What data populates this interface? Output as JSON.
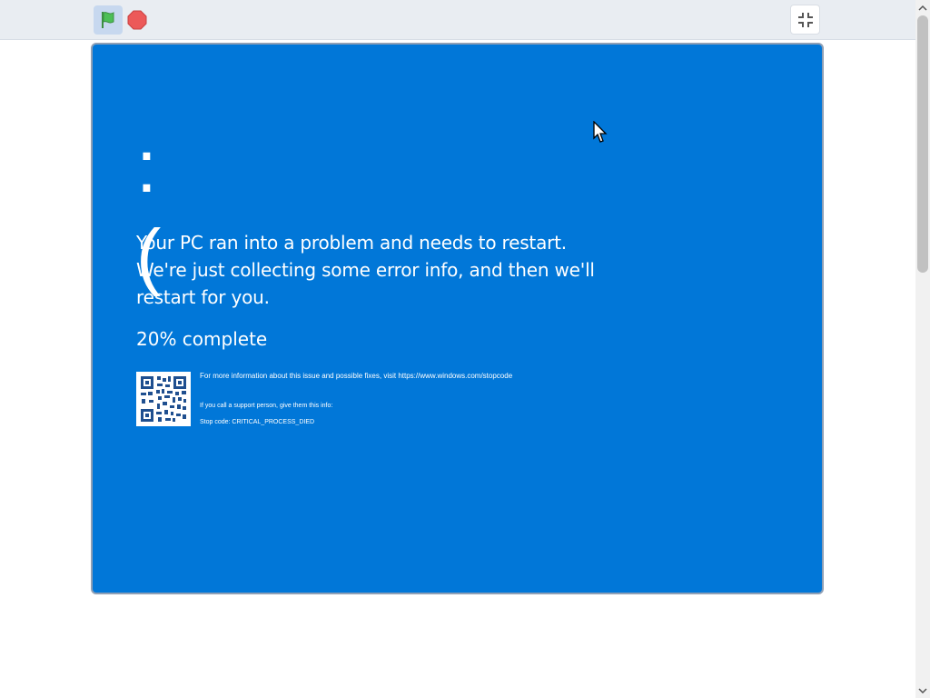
{
  "toolbar": {
    "green_flag_icon": "green-flag-icon",
    "stop_icon": "stop-sign-icon",
    "fullscreen_icon": "exit-fullscreen-icon"
  },
  "stage": {
    "background_color": "#0177d8",
    "face_text": ":(",
    "main_message": "Your PC ran into a problem and needs to restart. We're just collecting some error info, and then we'll restart for you.",
    "progress_text": "20% complete",
    "info_line_1": "For more information about this issue and possible fixes, visit https://www.windows.com/stopcode",
    "info_line_2": "If you call a support person, give them this info:",
    "info_line_3": "Stop code: CRITICAL_PROCESS_DIED"
  },
  "colors": {
    "toolbar_bg": "#e9edf2",
    "bsod_blue": "#0177d8",
    "flag_green": "#4cbf56",
    "stop_red": "#ec5959"
  }
}
